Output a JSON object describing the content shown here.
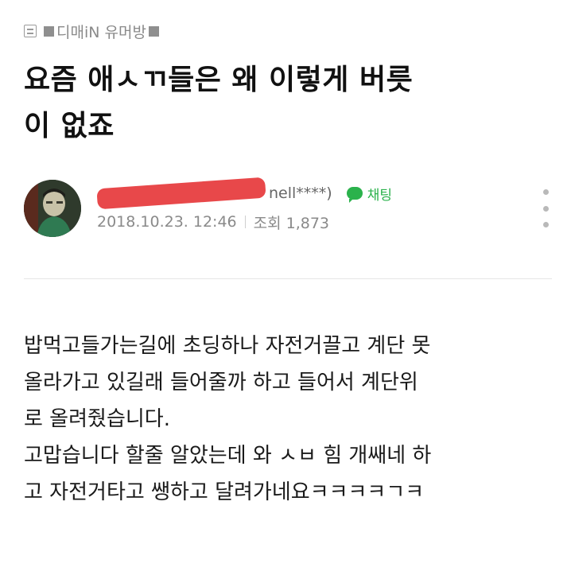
{
  "breadcrumb": {
    "label": "디매iN 유머방"
  },
  "post": {
    "title_lines": [
      "요즘 애ㅅㄲ들은 왜 이렇게 버릇",
      "이 없죠"
    ],
    "author_suffix": "nell****)",
    "chat_label": "채팅",
    "date": "2018.10.23. 12:46",
    "views": "조회 1,873",
    "body_lines": [
      "밥먹고들가는길에 초딩하나 자전거끌고 계단 못",
      "올라가고 있길래 들어줄까 하고 들어서 계단위",
      "로 올려줬습니다.",
      "고맙습니다 할줄 알았는데 와 ㅅㅂ 힘 개쌔네 하",
      "고 자전거타고 쌩하고 달려가네요ㅋㅋㅋㅋㄱㅋ"
    ]
  },
  "colors": {
    "chat_green": "#2bb24c",
    "redaction_red": "#e8484a"
  },
  "icons": {
    "list": "list-icon",
    "chat": "chat-bubble-icon",
    "more": "more-vertical-icon"
  }
}
